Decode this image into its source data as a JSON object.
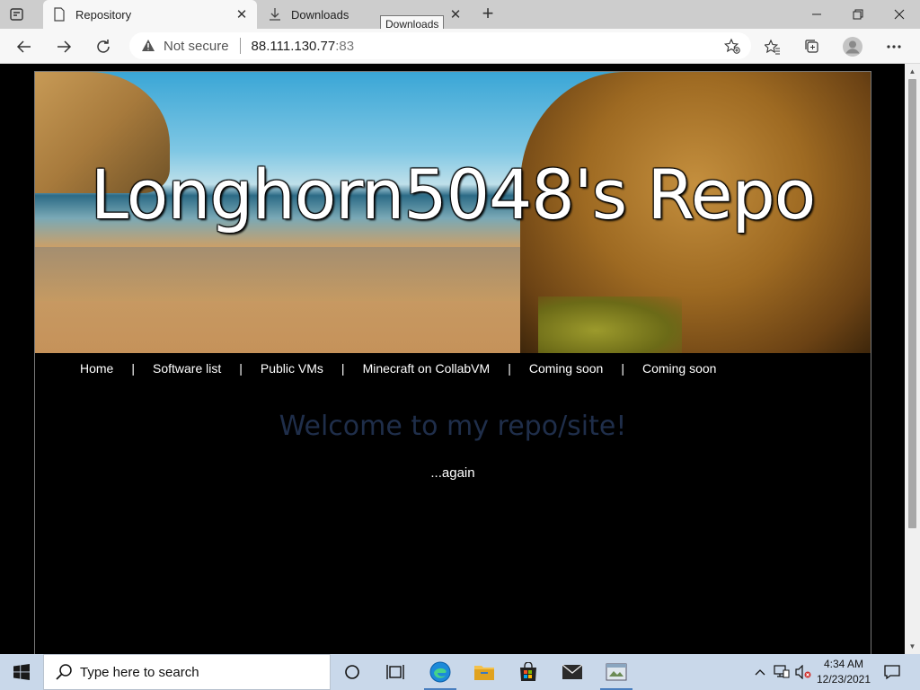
{
  "browser": {
    "tabs": [
      {
        "title": "Repository",
        "icon": "page-icon",
        "active": true
      },
      {
        "title": "Downloads",
        "icon": "download-icon",
        "active": false
      }
    ],
    "tooltip": "Downloads",
    "address": {
      "security_label": "Not secure",
      "host": "88.111.130.77",
      "port": ":83"
    }
  },
  "site": {
    "title": "Longhorn5048's Repo",
    "nav": [
      "Home",
      "Software list",
      "Public VMs",
      "Minecraft on CollabVM",
      "Coming soon",
      "Coming soon"
    ],
    "nav_separator": "|",
    "heading": "Welcome to my repo/site!",
    "subtext": "...again",
    "colors": {
      "heading": "#1f2e4a",
      "background": "#000000",
      "text": "#ffffff"
    }
  },
  "taskbar": {
    "search_placeholder": "Type here to search",
    "time": "4:34 AM",
    "date": "12/23/2021",
    "apps": [
      "task-view-icon",
      "edge-icon",
      "file-explorer-icon",
      "store-icon",
      "mail-icon",
      "browser-app-icon"
    ]
  }
}
